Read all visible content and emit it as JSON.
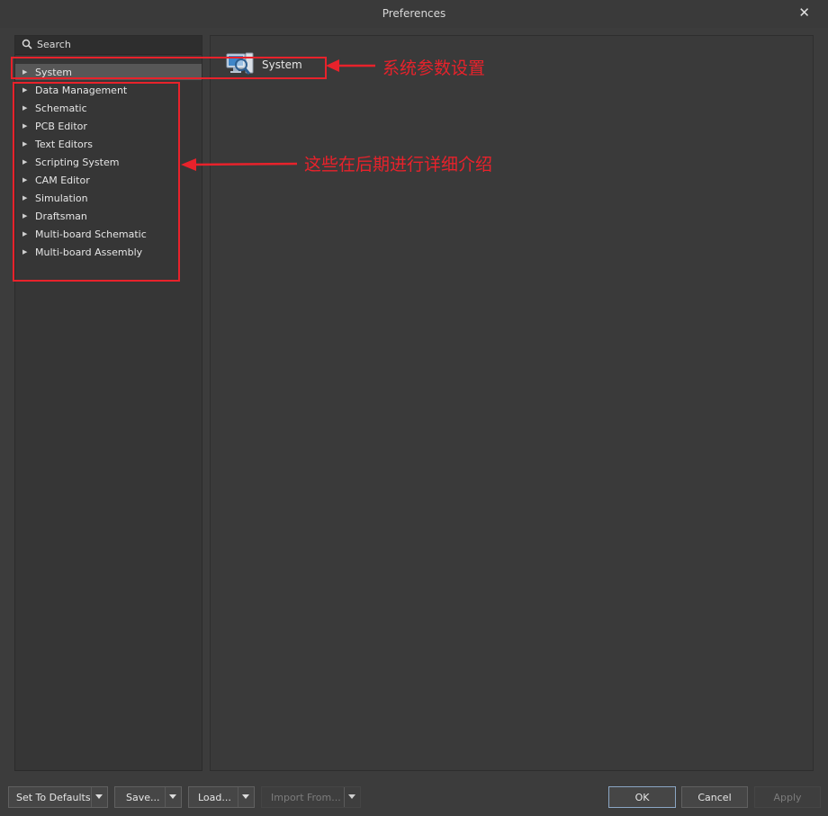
{
  "window": {
    "title": "Preferences",
    "close_glyph": "✕"
  },
  "search": {
    "placeholder": "Search"
  },
  "tree": [
    {
      "label": "System",
      "selected": true
    },
    {
      "label": "Data Management"
    },
    {
      "label": "Schematic"
    },
    {
      "label": "PCB Editor"
    },
    {
      "label": "Text Editors"
    },
    {
      "label": "Scripting System"
    },
    {
      "label": "CAM Editor"
    },
    {
      "label": "Simulation"
    },
    {
      "label": "Draftsman"
    },
    {
      "label": "Multi-board Schematic"
    },
    {
      "label": "Multi-board Assembly"
    }
  ],
  "content": {
    "system_label": "System"
  },
  "annotations": {
    "system_note": "系统参数设置",
    "others_note": "这些在后期进行详细介绍",
    "color": "#e8222b"
  },
  "buttons": {
    "set_defaults": "Set To Defaults",
    "save": "Save...",
    "load": "Load...",
    "import_from": "Import From...",
    "ok": "OK",
    "cancel": "Cancel",
    "apply": "Apply"
  }
}
